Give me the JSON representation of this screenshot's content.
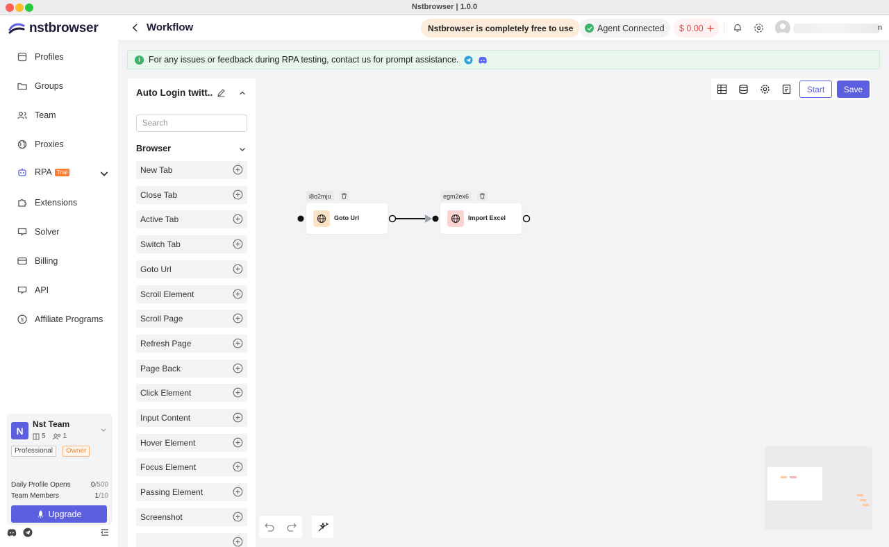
{
  "window": {
    "title": "Nstbrowser | 1.0.0"
  },
  "brand": {
    "name": "nstbrowser",
    "accent": "#5b5fe0"
  },
  "sidebar": {
    "items": [
      {
        "label": "Profiles",
        "icon": "profiles-icon"
      },
      {
        "label": "Groups",
        "icon": "folder-icon"
      },
      {
        "label": "Team",
        "icon": "team-icon"
      },
      {
        "label": "Proxies",
        "icon": "globe-icon"
      },
      {
        "label": "RPA",
        "icon": "robot-icon",
        "badge": "Trial"
      },
      {
        "label": "Extensions",
        "icon": "puzzle-icon"
      },
      {
        "label": "Solver",
        "icon": "solver-icon"
      },
      {
        "label": "Billing",
        "icon": "card-icon"
      },
      {
        "label": "API",
        "icon": "api-icon"
      },
      {
        "label": "Affiliate Programs",
        "icon": "dollar-icon"
      }
    ],
    "team": {
      "avatar_letter": "N",
      "name": "Nst Team",
      "profiles_count": "5",
      "members_count": "1",
      "plan": "Professional",
      "role": "Owner",
      "daily_opens_label": "Daily Profile Opens",
      "daily_opens_used": "0",
      "daily_opens_limit": "/500",
      "members_label": "Team Members",
      "members_used": "1",
      "members_limit": "/10",
      "upgrade_label": "Upgrade"
    }
  },
  "header": {
    "title": "Workflow",
    "free_notice": "Nstbrowser is completely free to use",
    "agent_status": "Agent Connected",
    "balance": "$ 0.00",
    "user_initial": "n"
  },
  "info": {
    "message": "For any issues or feedback during RPA testing, contact us for prompt assistance."
  },
  "panel": {
    "workflow_name": "Auto Login twitt...",
    "search_placeholder": "Search",
    "group": "Browser",
    "actions": [
      "New Tab",
      "Close Tab",
      "Active Tab",
      "Switch Tab",
      "Goto Url",
      "Scroll Element",
      "Scroll Page",
      "Refresh Page",
      "Page Back",
      "Click Element",
      "Input Content",
      "Hover Element",
      "Focus Element",
      "Passing Element",
      "Screenshot"
    ]
  },
  "toolbar": {
    "start_label": "Start",
    "save_label": "Save"
  },
  "nodes": [
    {
      "id": "i8o2mju",
      "label": "Goto Url",
      "icon_bg": "#fde3c6"
    },
    {
      "id": "egm2ex6",
      "label": "Import Excel",
      "icon_bg": "#fbd3d3"
    }
  ]
}
